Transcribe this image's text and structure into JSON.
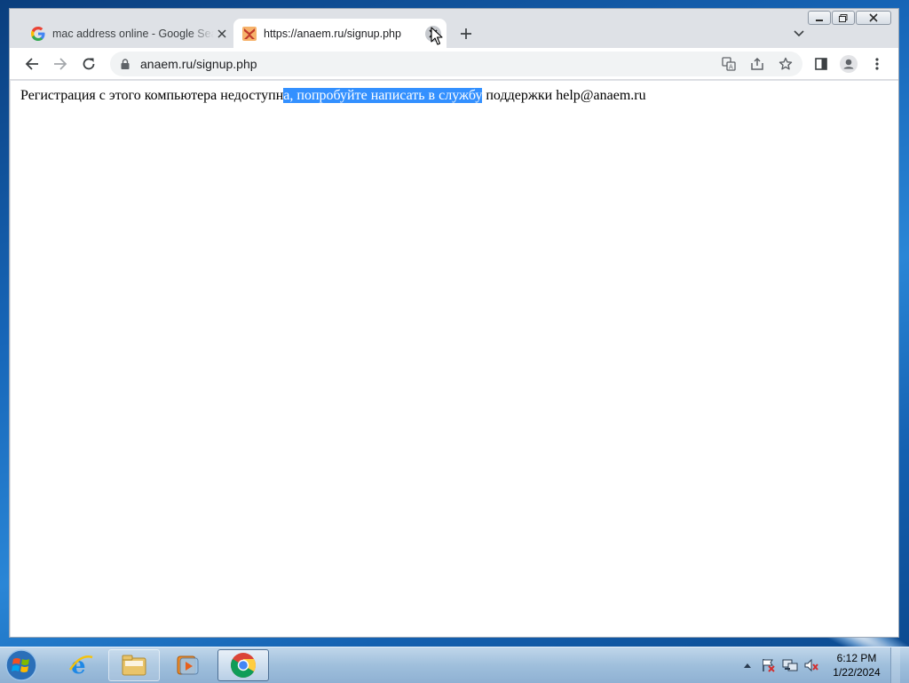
{
  "browser": {
    "tabs": [
      {
        "title": "mac address online - Google Search",
        "favicon": "google-g-icon",
        "active": false
      },
      {
        "title": "https://anaem.ru/signup.php",
        "favicon": "anaem-site-icon",
        "active": true
      }
    ],
    "address": {
      "url": "anaem.ru/signup.php"
    },
    "toolbar_icons": [
      "back-icon",
      "forward-icon",
      "reload-icon",
      "lock-icon",
      "translate-icon",
      "share-icon",
      "bookmark-star-icon",
      "side-panel-icon",
      "profile-icon",
      "menu-icon"
    ]
  },
  "page": {
    "message_before": "Регистрация с этого компьютера недоступн",
    "message_selected": "а, попробуйте написать в службу",
    "message_after": " поддержки help@anaem.ru"
  },
  "taskbar": {
    "pinned": [
      "internet-explorer-icon",
      "file-explorer-icon",
      "media-player-icon",
      "chrome-icon"
    ],
    "clock": {
      "time": "6:12 PM",
      "date": "1/22/2024"
    }
  },
  "colors": {
    "selection": "#3390ff",
    "tabstrip": "#dee1e6",
    "desktop": "#1b67b3"
  }
}
